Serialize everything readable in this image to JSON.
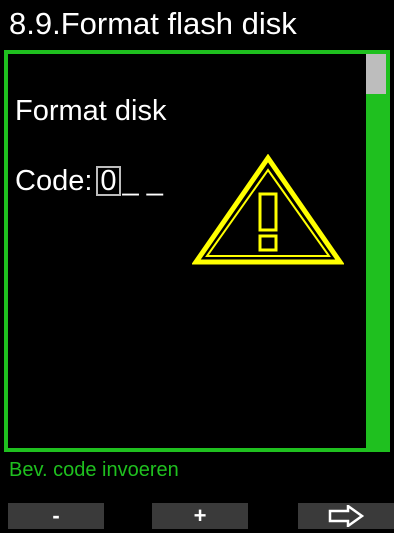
{
  "header": {
    "title": "8.9.Format flash disk"
  },
  "main": {
    "heading": "Format disk",
    "code_label": "Code:",
    "code_digit": "0",
    "code_blanks": "_ _",
    "warning_icon": "warning-triangle-icon"
  },
  "status": {
    "hint": "Bev. code invoeren"
  },
  "softkeys": {
    "minus_label": "-",
    "plus_label": "+",
    "next_icon": "arrow-right-icon"
  },
  "colors": {
    "accent": "#1fc01f",
    "warning": "#ffff00",
    "scroll_thumb": "#bdbdbd",
    "softkey_bg": "#3a3a3a"
  }
}
